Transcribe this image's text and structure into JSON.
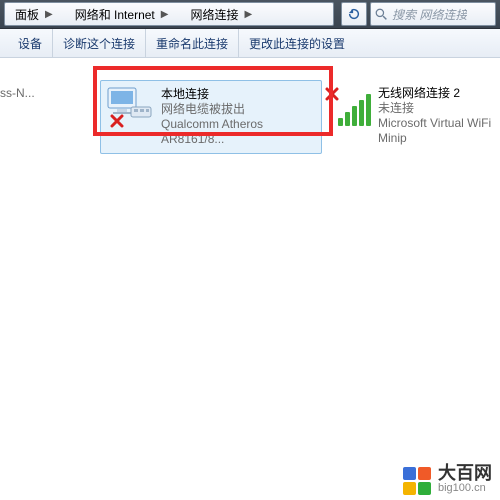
{
  "breadcrumb": [
    "面板",
    "网络和 Internet",
    "网络连接"
  ],
  "search": {
    "placeholder": "搜索 网络连接"
  },
  "toolbar": [
    "设备",
    "诊断这个连接",
    "重命名此连接",
    "更改此连接的设置"
  ],
  "items": [
    {
      "title": "",
      "status": "",
      "device": "crino(R) Wireless-N..."
    },
    {
      "title": "本地连接",
      "status": "网络电缆被拔出",
      "device": "Qualcomm Atheros AR8161/8..."
    },
    {
      "title": "无线网络连接 2",
      "status": "未连接",
      "device": "Microsoft Virtual WiFi Minip"
    }
  ],
  "watermark": {
    "name": "大百网",
    "url": "big100.cn",
    "colors": [
      "background:#3a6fd8",
      "background:#f05a28",
      "background:#f4b400",
      "background:#2fae3a"
    ]
  }
}
